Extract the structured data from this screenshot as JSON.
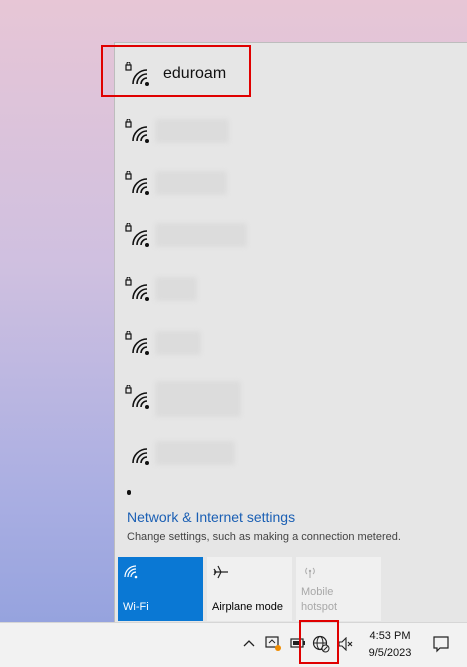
{
  "networks": [
    {
      "name": "eduroam",
      "secured": true
    },
    {
      "name": "",
      "secured": true
    },
    {
      "name": "",
      "secured": true
    },
    {
      "name": "",
      "secured": true
    },
    {
      "name": "",
      "secured": true
    },
    {
      "name": "",
      "secured": true
    },
    {
      "name": "",
      "secured": true
    },
    {
      "name": "",
      "secured": false
    }
  ],
  "settings": {
    "link": "Network & Internet settings",
    "description": "Change settings, such as making a connection metered."
  },
  "quick_actions": [
    {
      "label": "Wi-Fi",
      "state": "on",
      "icon": "wifi-icon"
    },
    {
      "label": "Airplane mode",
      "state": "off",
      "icon": "airplane-icon"
    },
    {
      "label": "Mobile hotspot",
      "state": "disabled",
      "icon": "hotspot-icon"
    }
  ],
  "taskbar": {
    "time": "4:53 PM",
    "date": "9/5/2023",
    "icons": [
      "chevron-up-icon",
      "meet-now-icon",
      "battery-icon",
      "globe-network-icon",
      "speaker-muted-icon",
      "notifications-icon"
    ]
  },
  "colors": {
    "accent": "#0a78d4",
    "highlight": "#e00000",
    "link": "#1a5fb4"
  }
}
